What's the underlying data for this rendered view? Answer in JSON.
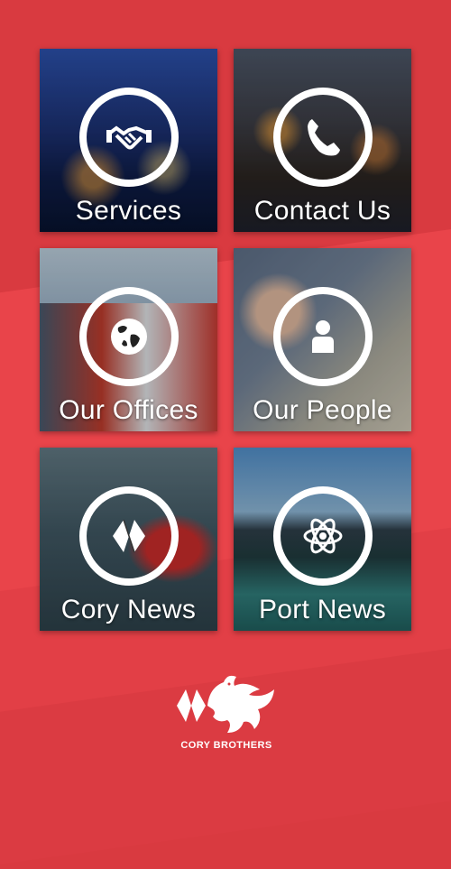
{
  "tiles": [
    {
      "id": "services",
      "label": "Services",
      "icon": "handshake-icon"
    },
    {
      "id": "contact",
      "label": "Contact Us",
      "icon": "phone-icon"
    },
    {
      "id": "offices",
      "label": "Our Offices",
      "icon": "globe-icon"
    },
    {
      "id": "people",
      "label": "Our People",
      "icon": "person-icon"
    },
    {
      "id": "corynews",
      "label": "Cory News",
      "icon": "cory-logo-icon"
    },
    {
      "id": "portnews",
      "label": "Port News",
      "icon": "atom-icon"
    }
  ],
  "footer": {
    "brand": "CORY BROTHERS",
    "logo_icon": "dragon-logo-icon"
  },
  "colors": {
    "background": "#d93a40",
    "accent": "#e9444a",
    "icon": "#ffffff"
  }
}
